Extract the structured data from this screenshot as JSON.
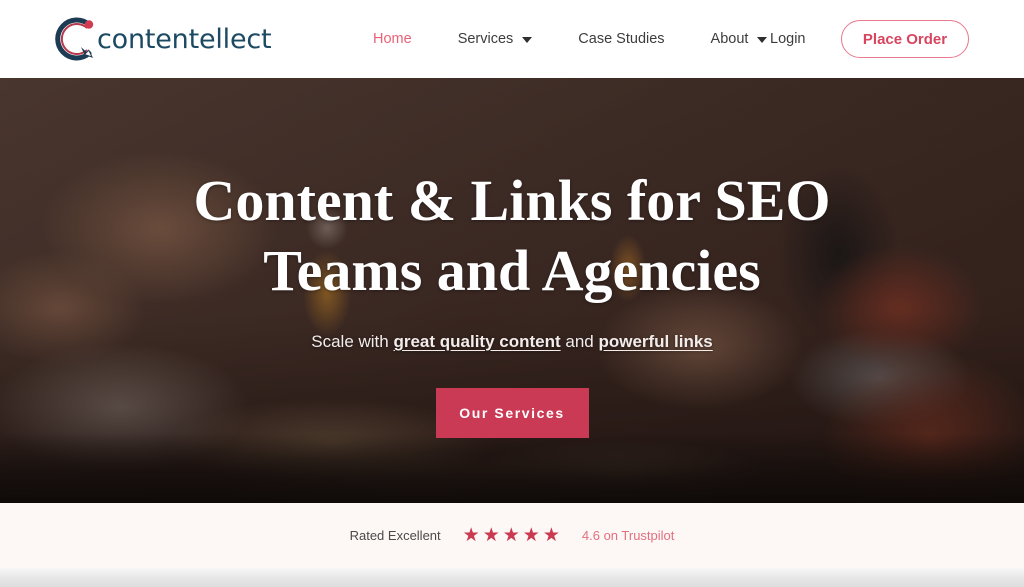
{
  "brand": {
    "name": "contentellect",
    "logo_icon": "c-arc-pencil-logo",
    "navy": "#1d4a63",
    "crimson": "#cb3a55",
    "pink": "#e8637a"
  },
  "header": {
    "nav": [
      {
        "label": "Home",
        "active": true,
        "has_dropdown": false
      },
      {
        "label": "Services",
        "active": false,
        "has_dropdown": true
      },
      {
        "label": "Case Studies",
        "active": false,
        "has_dropdown": false
      },
      {
        "label": "About",
        "active": false,
        "has_dropdown": true
      }
    ],
    "login_label": "Login",
    "place_order_label": "Place Order"
  },
  "hero": {
    "title_line1": "Content & Links for SEO",
    "title_line2": "Teams and Agencies",
    "sub_prefix": "Scale with ",
    "sub_bold1": "great quality content",
    "sub_middle": " and ",
    "sub_bold2": "powerful links",
    "cta_label": "Our Services"
  },
  "trust": {
    "label": "Rated Excellent",
    "stars": 5,
    "star_glyph": "★",
    "score_text": "4.6 on Trustpilot",
    "star_color": "#c9394f"
  }
}
